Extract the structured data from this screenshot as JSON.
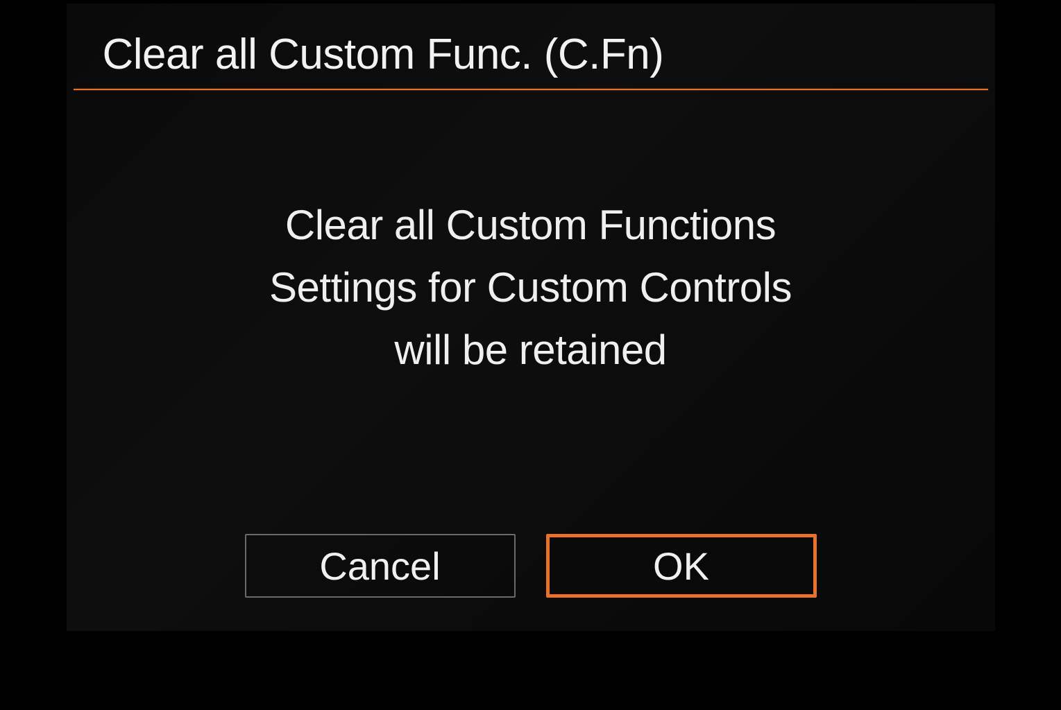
{
  "header": {
    "title": "Clear all Custom Func. (C.Fn)"
  },
  "message": {
    "line1": "Clear all Custom Functions",
    "line2": "Settings for Custom Controls",
    "line3": "will be retained"
  },
  "buttons": {
    "cancel": "Cancel",
    "ok": "OK"
  },
  "colors": {
    "accent": "#e8722a",
    "text": "#f0f0f0",
    "background": "#0a0a0a"
  }
}
